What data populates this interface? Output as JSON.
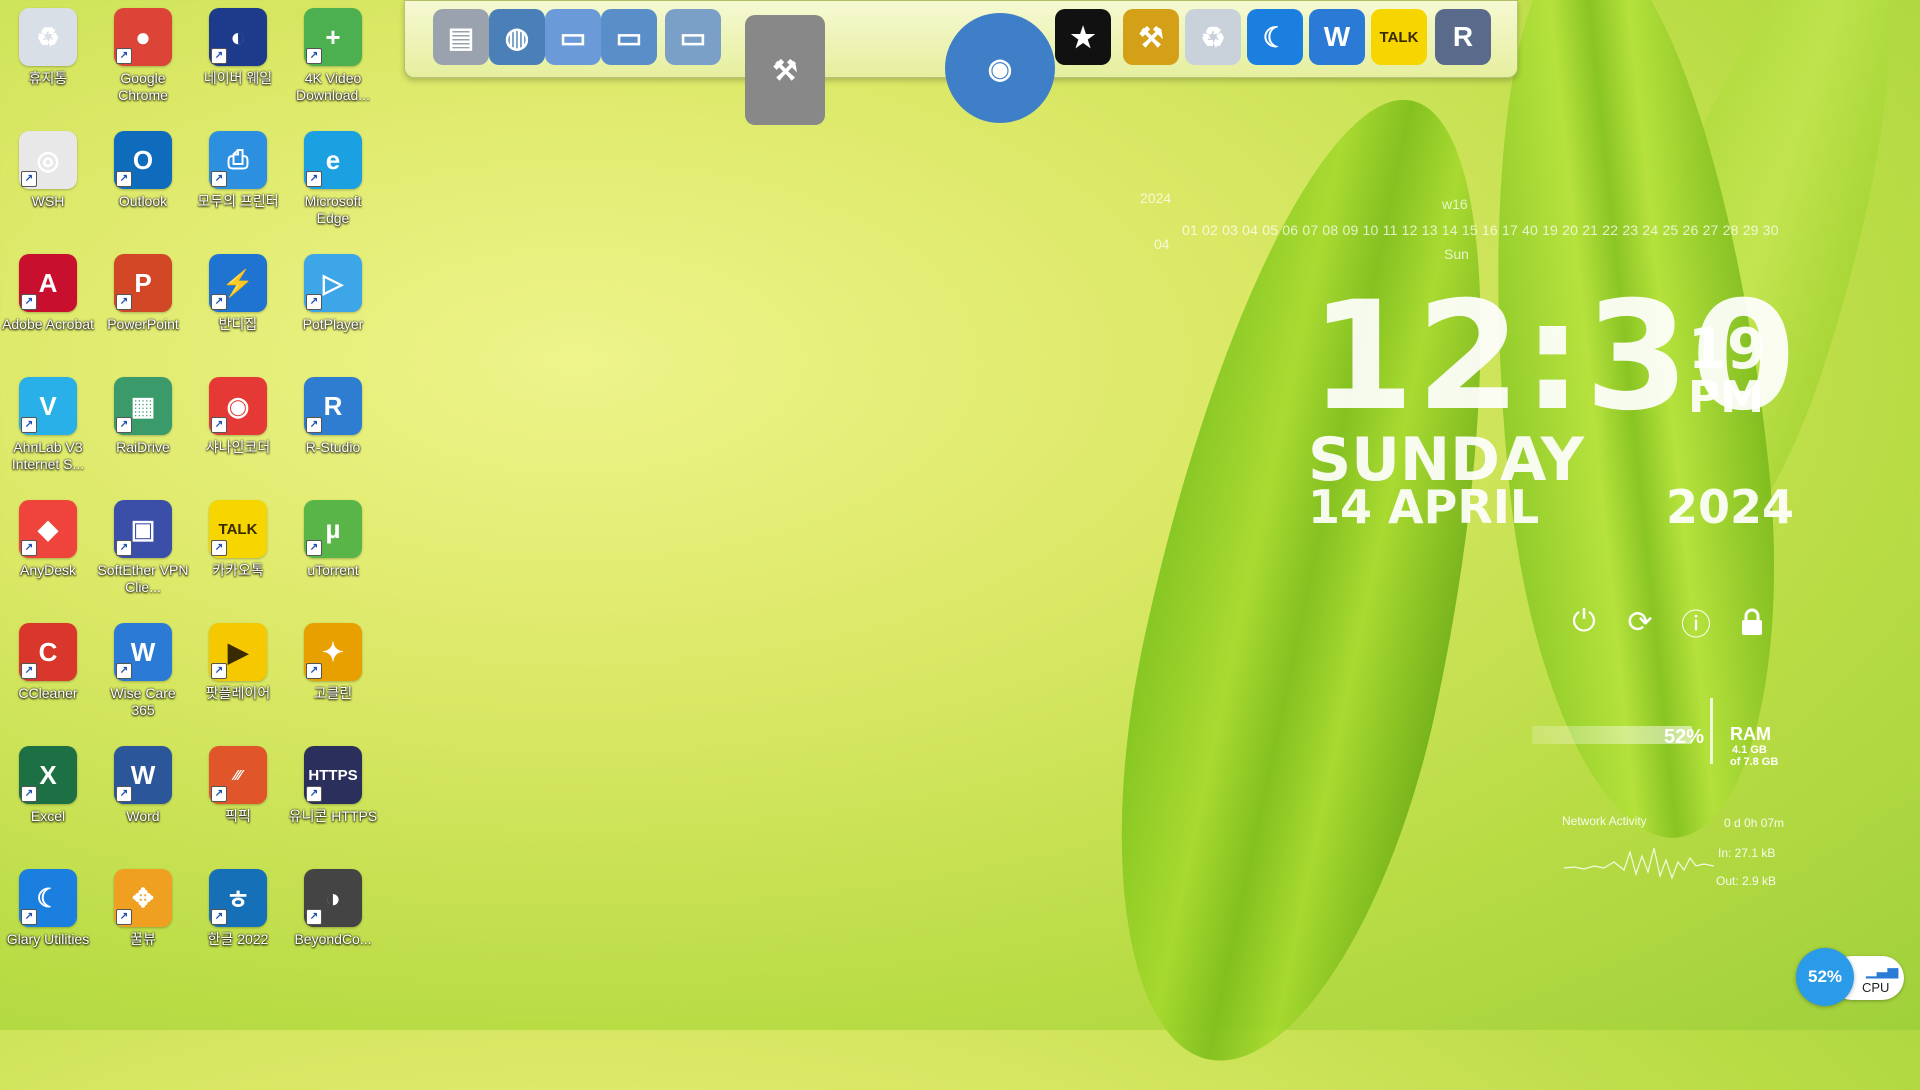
{
  "desktop_icons": [
    {
      "label": "휴지통",
      "icon": "recycle-bin-icon",
      "color": "#d8dfe6",
      "glyph": "♻",
      "col": 0,
      "row": 0
    },
    {
      "label": "Google Chrome",
      "icon": "chrome-icon",
      "color": "#db4437",
      "glyph": "●",
      "col": 1,
      "row": 0
    },
    {
      "label": "네이버 웨일",
      "icon": "whale-icon",
      "color": "#1e3a8a",
      "glyph": "◐",
      "col": 2,
      "row": 0
    },
    {
      "label": "4K Video Download...",
      "icon": "cloud-download-icon",
      "color": "#4caf50",
      "glyph": "+",
      "col": 3,
      "row": 0
    },
    {
      "label": "WSH",
      "icon": "script-file-icon",
      "color": "#e8e8e8",
      "glyph": "◎",
      "col": 0,
      "row": 1
    },
    {
      "label": "Outlook",
      "icon": "outlook-icon",
      "color": "#0f6cbd",
      "glyph": "O",
      "col": 1,
      "row": 1
    },
    {
      "label": "모두의 프린터",
      "icon": "printer-icon",
      "color": "#2d8fe0",
      "glyph": "⎙",
      "col": 2,
      "row": 1
    },
    {
      "label": "Microsoft Edge",
      "icon": "edge-icon",
      "color": "#1ba0e2",
      "glyph": "e",
      "col": 3,
      "row": 1
    },
    {
      "label": "Adobe Acrobat",
      "icon": "acrobat-icon",
      "color": "#c8102e",
      "glyph": "A",
      "col": 0,
      "row": 2
    },
    {
      "label": "PowerPoint",
      "icon": "powerpoint-icon",
      "color": "#d24726",
      "glyph": "P",
      "col": 1,
      "row": 2
    },
    {
      "label": "반디집",
      "icon": "bandizip-icon",
      "color": "#1f73d1",
      "glyph": "⚡",
      "col": 2,
      "row": 2
    },
    {
      "label": "PotPlayer",
      "icon": "potplayer-icon",
      "color": "#3da6e8",
      "glyph": "▷",
      "col": 3,
      "row": 2
    },
    {
      "label": "AhnLab V3 Internet S...",
      "icon": "v3-icon",
      "color": "#2ab0e8",
      "glyph": "V",
      "col": 0,
      "row": 3
    },
    {
      "label": "RaiDrive",
      "icon": "raidrive-icon",
      "color": "#3a9a6a",
      "glyph": "▦",
      "col": 1,
      "row": 3
    },
    {
      "label": "샤나인코더",
      "icon": "shana-encoder-icon",
      "color": "#e53935",
      "glyph": "◉",
      "col": 2,
      "row": 3
    },
    {
      "label": "R-Studio",
      "icon": "r-studio-icon",
      "color": "#2e7dd1",
      "glyph": "R",
      "col": 3,
      "row": 3
    },
    {
      "label": "AnyDesk",
      "icon": "anydesk-icon",
      "color": "#ef443b",
      "glyph": "◆",
      "col": 0,
      "row": 4
    },
    {
      "label": "SoftEther VPN Clie...",
      "icon": "softether-icon",
      "color": "#3c4fa8",
      "glyph": "▣",
      "col": 1,
      "row": 4
    },
    {
      "label": "카카오톡",
      "icon": "kakaotalk-icon",
      "color": "#f7d600",
      "glyph": "TALK",
      "col": 2,
      "row": 4
    },
    {
      "label": "uTorrent",
      "icon": "utorrent-icon",
      "color": "#59b548",
      "glyph": "µ",
      "col": 3,
      "row": 4
    },
    {
      "label": "CCleaner",
      "icon": "ccleaner-icon",
      "color": "#d9372b",
      "glyph": "C",
      "col": 0,
      "row": 5
    },
    {
      "label": "Wise Care 365",
      "icon": "wise-care-icon",
      "color": "#2a7ad6",
      "glyph": "W",
      "col": 1,
      "row": 5
    },
    {
      "label": "팟플레이어",
      "icon": "pot-player-icon",
      "color": "#f5c800",
      "glyph": "▶",
      "col": 2,
      "row": 5
    },
    {
      "label": "고클린",
      "icon": "goclean-icon",
      "color": "#e8a000",
      "glyph": "✦",
      "col": 3,
      "row": 5
    },
    {
      "label": "Excel",
      "icon": "excel-icon",
      "color": "#1d7044",
      "glyph": "X",
      "col": 0,
      "row": 6
    },
    {
      "label": "Word",
      "icon": "word-icon",
      "color": "#2b579a",
      "glyph": "W",
      "col": 1,
      "row": 6
    },
    {
      "label": "픽픽",
      "icon": "picpick-icon",
      "color": "#e0562a",
      "glyph": "⁄⁄⁄",
      "col": 2,
      "row": 6
    },
    {
      "label": "유니콘 HTTPS",
      "icon": "unicorn-https-icon",
      "color": "#2b2f5c",
      "glyph": "HTTPS",
      "col": 3,
      "row": 6
    },
    {
      "label": "Glary Utilities",
      "icon": "glary-icon",
      "color": "#1b7fe0",
      "glyph": "☾",
      "col": 0,
      "row": 7
    },
    {
      "label": "꿀뷰",
      "icon": "honeyview-icon",
      "color": "#f0a020",
      "glyph": "✥",
      "col": 1,
      "row": 7
    },
    {
      "label": "한글 2022",
      "icon": "hangul-icon",
      "color": "#1570b8",
      "glyph": "ㅎ",
      "col": 2,
      "row": 7
    },
    {
      "label": "BeyondCo...",
      "icon": "beyond-compare-icon",
      "color": "#444",
      "glyph": "◑",
      "col": 3,
      "row": 7
    }
  ],
  "dock_items": [
    {
      "icon": "notepad-icon",
      "glyph": "▤",
      "color": "#9aa3ad"
    },
    {
      "icon": "network-globe-icon",
      "glyph": "◍",
      "color": "#4a7fb8"
    },
    {
      "icon": "folder-icon",
      "glyph": "▭",
      "color": "#6a9bd8"
    },
    {
      "icon": "folder-open-icon",
      "glyph": "▭",
      "color": "#5a8ec8"
    },
    {
      "icon": "folder-images-icon",
      "glyph": "▭",
      "color": "#7aa0c8"
    },
    {
      "icon": "system-tools-icon",
      "glyph": "⚒",
      "color": "#888"
    },
    {
      "icon": "globe-large-icon",
      "glyph": "◉",
      "color": "#3f7fc8"
    },
    {
      "icon": "tshirt-icon",
      "glyph": "★",
      "color": "#111"
    },
    {
      "icon": "tools-icon",
      "glyph": "⚒",
      "color": "#d4a017"
    },
    {
      "icon": "recycle-bin-icon",
      "glyph": "♻",
      "color": "#c9d2da"
    },
    {
      "icon": "glary-moon-icon",
      "glyph": "☾",
      "color": "#1b7fe0"
    },
    {
      "icon": "wise-shield-icon",
      "glyph": "W",
      "color": "#2a7ad6"
    },
    {
      "icon": "kakaotalk-icon",
      "glyph": "TALK",
      "color": "#f7d600"
    },
    {
      "icon": "r-undelete-icon",
      "glyph": "R",
      "color": "#5a6a8a"
    }
  ],
  "calendar": {
    "year": "2024",
    "month": "04",
    "week": "w16",
    "days": "01 02 03 04 05 06 07 08 09 10 11 12 13 14 15 16 17 40 19 20 21 22 23 24 25 26 27 28 29 30",
    "dow": "Sun"
  },
  "clock": {
    "time": "12:30",
    "seconds": "19",
    "ampm": "PM",
    "day": "SUNDAY",
    "date": "14 APRIL",
    "year": "2024"
  },
  "power": [
    {
      "icon": "power-icon",
      "glyph": "⏻"
    },
    {
      "icon": "restart-icon",
      "glyph": "⟳"
    },
    {
      "icon": "info-icon",
      "glyph": "ⓘ"
    },
    {
      "icon": "lock-icon",
      "glyph": "🔒"
    }
  ],
  "ram": {
    "percent": "52%",
    "label": "RAM",
    "used": "4.1 GB",
    "total": "of 7.8 GB"
  },
  "network": {
    "label": "Network Activity",
    "uptime": "0 d 0h 07m",
    "in": "In: 27.1 kB",
    "out": "Out: 2.9 kB"
  },
  "cpu": {
    "percent": "52%",
    "label": "CPU"
  }
}
